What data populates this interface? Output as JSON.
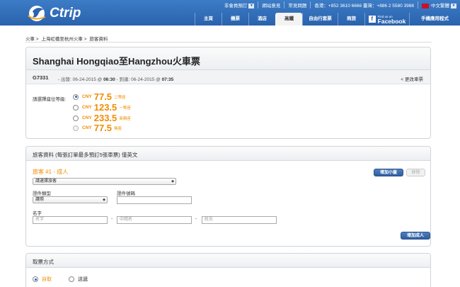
{
  "header": {
    "logo_text": "Ctrip",
    "top_links": [
      {
        "label": "非會員預訂",
        "dropdown": true
      },
      {
        "label": "網站意見",
        "dropdown": false
      },
      {
        "label": "常見問題",
        "dropdown": false
      },
      {
        "label": "香港：+852 3610 6666 臺灣：+886 2 5580 3988",
        "dropdown": false
      },
      {
        "label": "中文繁體",
        "dropdown": true
      }
    ],
    "nav": [
      {
        "label": "主頁",
        "active": false
      },
      {
        "label": "機票",
        "active": false
      },
      {
        "label": "酒店",
        "active": false
      },
      {
        "label": "高鐵",
        "active": true
      },
      {
        "label": "自由行套票",
        "active": false
      },
      {
        "label": "商旅",
        "active": false
      }
    ],
    "facebook": {
      "small": "Find us on",
      "big": "Facebook"
    },
    "app_label": "手機應用程式"
  },
  "breadcrumb": [
    "火車 >",
    "上海虹橋至杭州火車 >",
    "旅客資料"
  ],
  "trip": {
    "title": "Shanghai Hongqiao至Hangzhou火車票",
    "train_no": "G7331",
    "depart_prefix": "- 出發: 06-24-2015 @",
    "depart_time": "06:30",
    "arrive_prefix": "- 到達: 06-24-2015 @",
    "arrive_time": "07:35",
    "change_label": "< 更改車票"
  },
  "seats": {
    "label": "請選擇座位等級:",
    "options": [
      {
        "currency": "CNY",
        "price": "77.5",
        "name": "二等座",
        "selected": true,
        "disabled": false
      },
      {
        "currency": "CNY",
        "price": "123.5",
        "name": "一等座",
        "selected": false,
        "disabled": false
      },
      {
        "currency": "CNY",
        "price": "233.5",
        "name": "商務座",
        "selected": false,
        "disabled": false
      },
      {
        "currency": "CNY",
        "price": "77.5",
        "name": "無座",
        "selected": false,
        "disabled": true
      }
    ]
  },
  "passenger": {
    "section_title": "旅客資料 (每張訂單最多預訂5張車票) 僅英文",
    "pax_title": "旅客 #1 - 成人",
    "add_child": "增加小童",
    "remove": "移除",
    "select_pax": "請選擇旅客",
    "id_type_label": "證件類型",
    "id_type_value": "護照",
    "id_no_label": "證件號碼",
    "id_no_value": "",
    "name_label": "名字",
    "first_name_placeholder": "名字",
    "middle_name_placeholder": "中間名",
    "last_name_placeholder": "姓氏",
    "dash": "-",
    "add_adult": "增加成人"
  },
  "delivery": {
    "section_title": "取票方式",
    "options": [
      {
        "label": "自取",
        "selected": true
      },
      {
        "label": "送遞",
        "selected": false
      }
    ]
  }
}
